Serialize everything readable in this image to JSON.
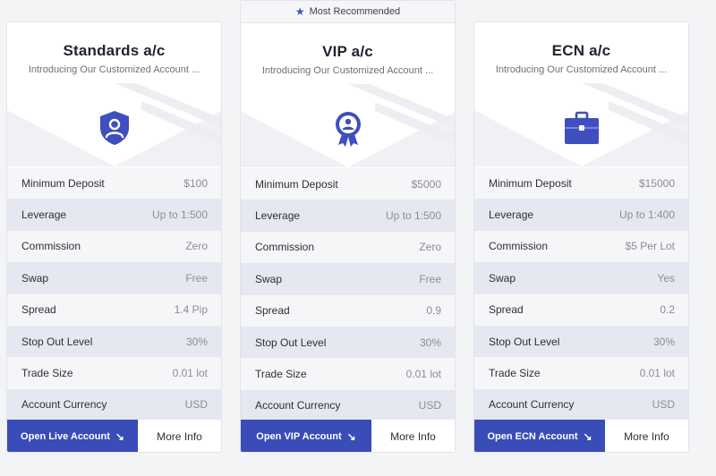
{
  "recommended_badge": "Most Recommended",
  "cards": [
    {
      "title": "Standards a/c",
      "subtitle": "Introducing Our Customized Account ...",
      "icon": "shield-user-icon",
      "rows": [
        {
          "label": "Minimum Deposit",
          "value": "$100"
        },
        {
          "label": "Leverage",
          "value": "Up to 1:500"
        },
        {
          "label": "Commission",
          "value": "Zero"
        },
        {
          "label": "Swap",
          "value": "Free"
        },
        {
          "label": "Spread",
          "value": "1.4 Pip"
        },
        {
          "label": "Stop Out Level",
          "value": "30%"
        },
        {
          "label": "Trade Size",
          "value": "0.01 lot"
        },
        {
          "label": "Account Currency",
          "value": "USD"
        }
      ],
      "primary_button": "Open Live Account",
      "secondary_button": "More Info"
    },
    {
      "title": "VIP a/c",
      "subtitle": "Introducing Our Customized Account ...",
      "icon": "award-badge-icon",
      "rows": [
        {
          "label": "Minimum Deposit",
          "value": "$5000"
        },
        {
          "label": "Leverage",
          "value": "Up to 1:500"
        },
        {
          "label": "Commission",
          "value": "Zero"
        },
        {
          "label": "Swap",
          "value": "Free"
        },
        {
          "label": "Spread",
          "value": "0.9"
        },
        {
          "label": "Stop Out Level",
          "value": "30%"
        },
        {
          "label": "Trade Size",
          "value": "0.01 lot"
        },
        {
          "label": "Account Currency",
          "value": "USD"
        }
      ],
      "primary_button": "Open VIP Account",
      "secondary_button": "More Info"
    },
    {
      "title": "ECN a/c",
      "subtitle": "Introducing Our Customized Account ...",
      "icon": "briefcase-icon",
      "rows": [
        {
          "label": "Minimum Deposit",
          "value": "$15000"
        },
        {
          "label": "Leverage",
          "value": "Up to 1:400"
        },
        {
          "label": "Commission",
          "value": "$5 Per Lot"
        },
        {
          "label": "Swap",
          "value": "Yes"
        },
        {
          "label": "Spread",
          "value": "0.2"
        },
        {
          "label": "Stop Out Level",
          "value": "30%"
        },
        {
          "label": "Trade Size",
          "value": "0.01 lot"
        },
        {
          "label": "Account Currency",
          "value": "USD"
        }
      ],
      "primary_button": "Open ECN Account",
      "secondary_button": "More Info"
    }
  ],
  "colors": {
    "accent": "#3a4cb8",
    "icon": "#3f4fbf",
    "row_alt": "#e6e8f1",
    "row_base": "#f6f6f8"
  }
}
